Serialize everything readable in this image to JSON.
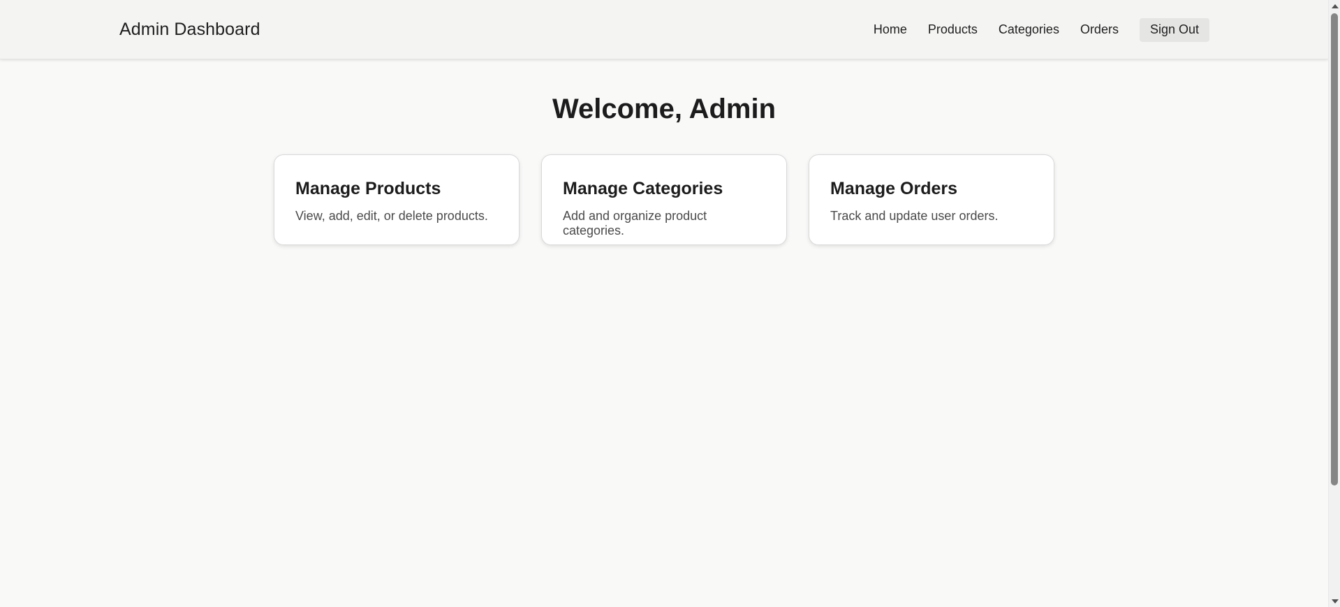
{
  "header": {
    "brand": "Admin Dashboard",
    "nav": [
      {
        "label": "Home"
      },
      {
        "label": "Products"
      },
      {
        "label": "Categories"
      },
      {
        "label": "Orders"
      }
    ],
    "signout_label": "Sign Out"
  },
  "main": {
    "welcome": "Welcome, Admin",
    "cards": [
      {
        "title": "Manage Products",
        "description": "View, add, edit, or delete products."
      },
      {
        "title": "Manage Categories",
        "description": "Add and organize product categories."
      },
      {
        "title": "Manage Orders",
        "description": "Track and update user orders."
      }
    ]
  },
  "scrollbar": {
    "up_icon": "triangle-up-icon",
    "down_icon": "triangle-down-icon"
  },
  "colors": {
    "page_background": "#f9f9f8",
    "navbar_background": "#f4f4f3",
    "card_background": "#ffffff",
    "signout_background": "#e5e5e4",
    "text_primary": "#1c1c1c",
    "text_secondary": "#4a4a4a"
  }
}
